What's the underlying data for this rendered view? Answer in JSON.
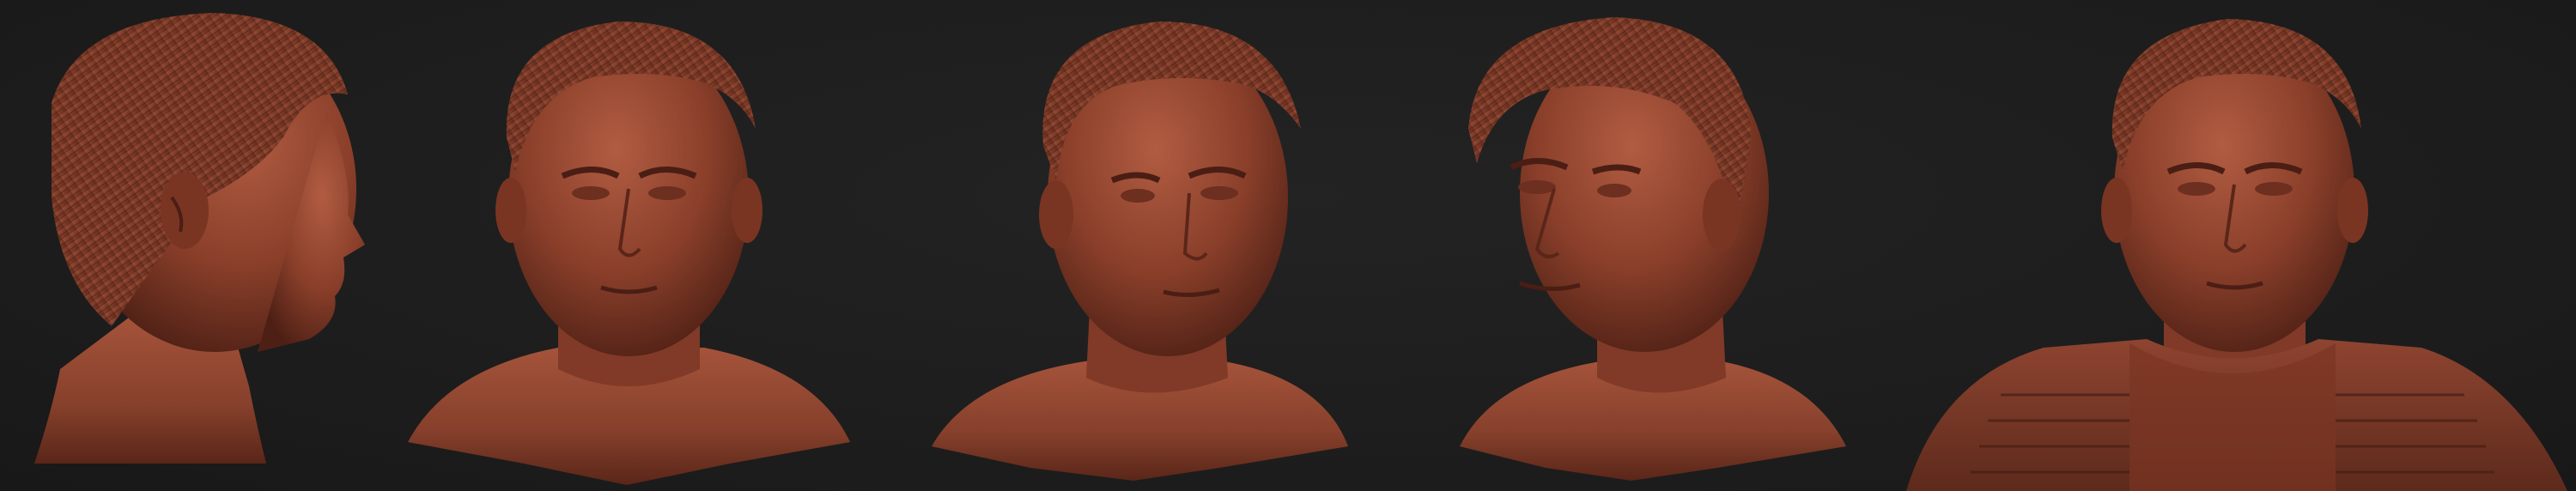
{
  "scene": {
    "background_color": "#1e1e1e",
    "clay_color": "#8a3f2a",
    "clay_highlight": "#c06a4e",
    "clay_shadow": "#4a1e14",
    "views": [
      {
        "id": "side-left",
        "kind": "profile-right-facing",
        "clothing": "none"
      },
      {
        "id": "front",
        "kind": "front",
        "clothing": "none"
      },
      {
        "id": "three-quarter-right",
        "kind": "three-quarter",
        "clothing": "none"
      },
      {
        "id": "three-quarter-left",
        "kind": "three-quarter-left",
        "clothing": "none"
      },
      {
        "id": "front-vest",
        "kind": "front",
        "clothing": "tactical-vest"
      }
    ]
  }
}
